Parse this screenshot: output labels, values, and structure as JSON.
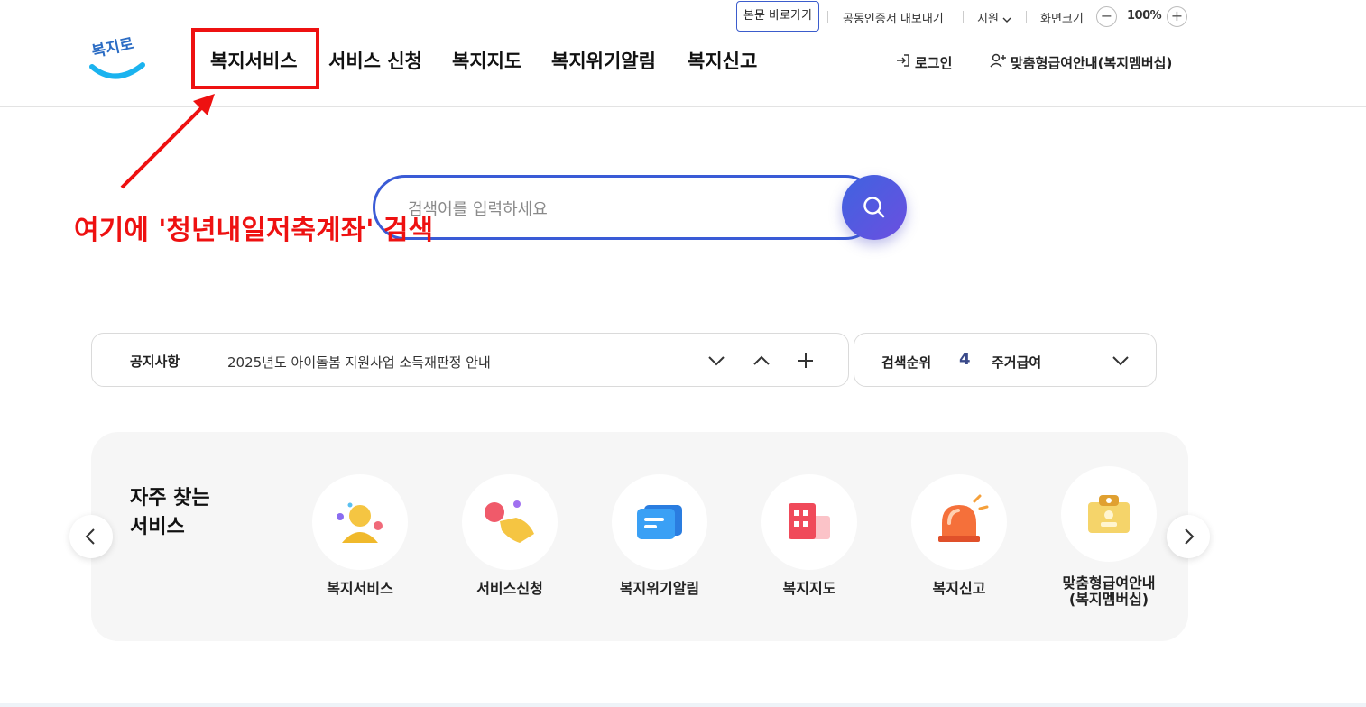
{
  "utility": {
    "skip_link": "본문 바로가기",
    "cert_export": "공동인증서 내보내기",
    "support": "지원",
    "font_size_label": "화면크기",
    "zoom_value": "100%",
    "zoom_minus": "−",
    "zoom_plus": "+"
  },
  "logo": {
    "text": "복지로"
  },
  "gnb": {
    "items": [
      "복지서비스",
      "서비스 신청",
      "복지지도",
      "복지위기알림",
      "복지신고"
    ]
  },
  "header_links": {
    "login": "로그인",
    "membership": "맞춤형급여안내(복지멤버십)"
  },
  "search": {
    "placeholder": "검색어를 입력하세요",
    "value": ""
  },
  "annotation": {
    "text": "여기에 '청년내일저축계좌' 검색",
    "color": "#ee1111"
  },
  "notice": {
    "label": "공지사항",
    "text": "2025년도 아이돌봄 지원사업 소득재판정 안내"
  },
  "rank": {
    "label": "검색순위",
    "number": "4",
    "keyword": "주거급여"
  },
  "frequent": {
    "title_line1": "자주 찾는",
    "title_line2": "서비스",
    "items": [
      {
        "label": "복지서비스",
        "icon": "person-icon"
      },
      {
        "label": "서비스신청",
        "icon": "hand-tap-icon"
      },
      {
        "label": "복지위기알림",
        "icon": "message-icon"
      },
      {
        "label": "복지지도",
        "icon": "building-icon"
      },
      {
        "label": "복지신고",
        "icon": "siren-icon"
      },
      {
        "label": "맞춤형급여안내\n(복지멤버십)",
        "label_line1": "맞춤형급여안내",
        "label_line2": "(복지멤버십)",
        "icon": "membership-card-icon"
      }
    ]
  },
  "colors": {
    "accent": "#3a5bd6",
    "highlight_box": "#ee1111",
    "panel_bg": "#f6f6f6"
  }
}
